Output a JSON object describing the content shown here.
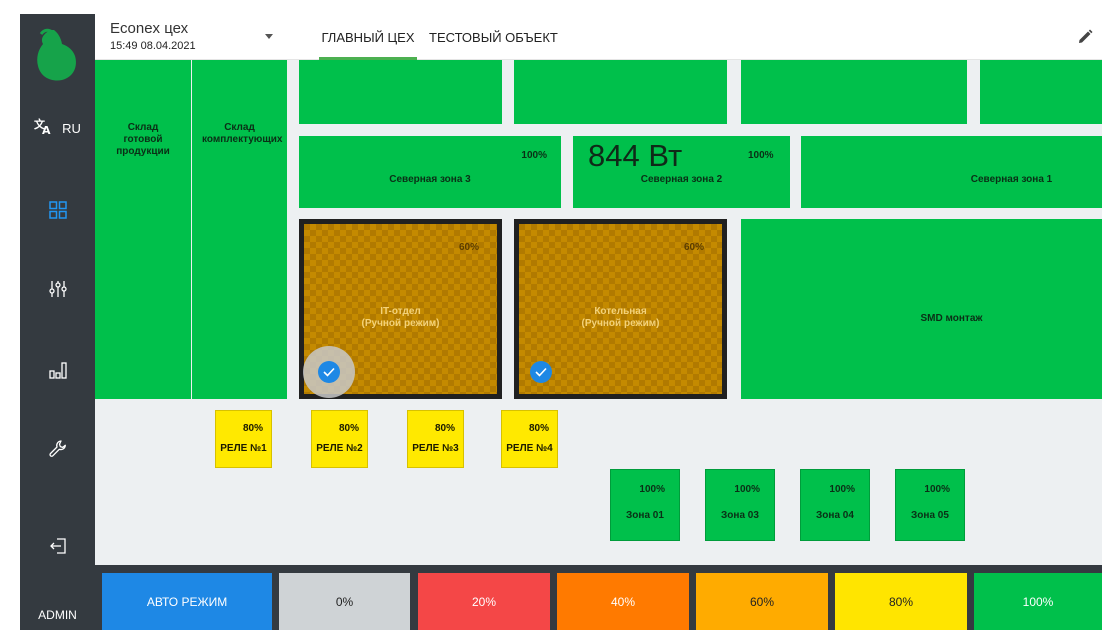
{
  "sidebar": {
    "language": "RU",
    "user": "ADMIN",
    "icons": [
      "pear-logo-icon",
      "translate-icon",
      "dashboard-grid-icon",
      "sliders-icon",
      "bar-chart-icon",
      "wrench-icon",
      "logout-icon"
    ]
  },
  "header": {
    "title": "Econex цех",
    "datetime": "15:49 08.04.2021",
    "tabs": [
      {
        "label": "ГЛАВНЫЙ ЦЕХ",
        "active": true
      },
      {
        "label": "ТЕСТОВЫЙ ОБЪЕКТ",
        "active": false
      }
    ]
  },
  "zones": {
    "storage_ready": "Склад готовой продукции",
    "storage_components": "Склад комплектующих",
    "north3": {
      "name": "Северная зона 3",
      "percent": "100%"
    },
    "north2": {
      "name": "Северная зона 2",
      "percent": "100%",
      "power": "844 Вт"
    },
    "north1": {
      "name": "Северная зона 1"
    },
    "it": {
      "name": "IT-отдел",
      "mode": "(Ручной режим)",
      "percent": "60%"
    },
    "boiler": {
      "name": "Котельная",
      "mode": "(Ручной режим)",
      "percent": "60%"
    },
    "smd": {
      "name": "SMD монтаж"
    }
  },
  "relays": [
    {
      "name": "РЕЛЕ №1",
      "percent": "80%"
    },
    {
      "name": "РЕЛЕ №2",
      "percent": "80%"
    },
    {
      "name": "РЕЛЕ №3",
      "percent": "80%"
    },
    {
      "name": "РЕЛЕ №4",
      "percent": "80%"
    }
  ],
  "small_zones": [
    {
      "name": "Зона 01",
      "percent": "100%"
    },
    {
      "name": "Зона 03",
      "percent": "100%"
    },
    {
      "name": "Зона 04",
      "percent": "100%"
    },
    {
      "name": "Зона 05",
      "percent": "100%"
    }
  ],
  "presets": [
    {
      "label": "АВТО РЕЖИМ",
      "color": "#1e88e5"
    },
    {
      "label": "0%",
      "color": "#cfd3d6"
    },
    {
      "label": "20%",
      "color": "#f44747"
    },
    {
      "label": "40%",
      "color": "#ff7a00"
    },
    {
      "label": "60%",
      "color": "#ffab00"
    },
    {
      "label": "80%",
      "color": "#ffe500"
    },
    {
      "label": "100%",
      "color": "#00c04b"
    }
  ],
  "colors": {
    "sidebar": "#343a40",
    "zone_green": "#00c04b",
    "relay_yellow": "#ffe900",
    "accent_blue": "#1e88e5",
    "tab_underline": "#4cb050"
  }
}
